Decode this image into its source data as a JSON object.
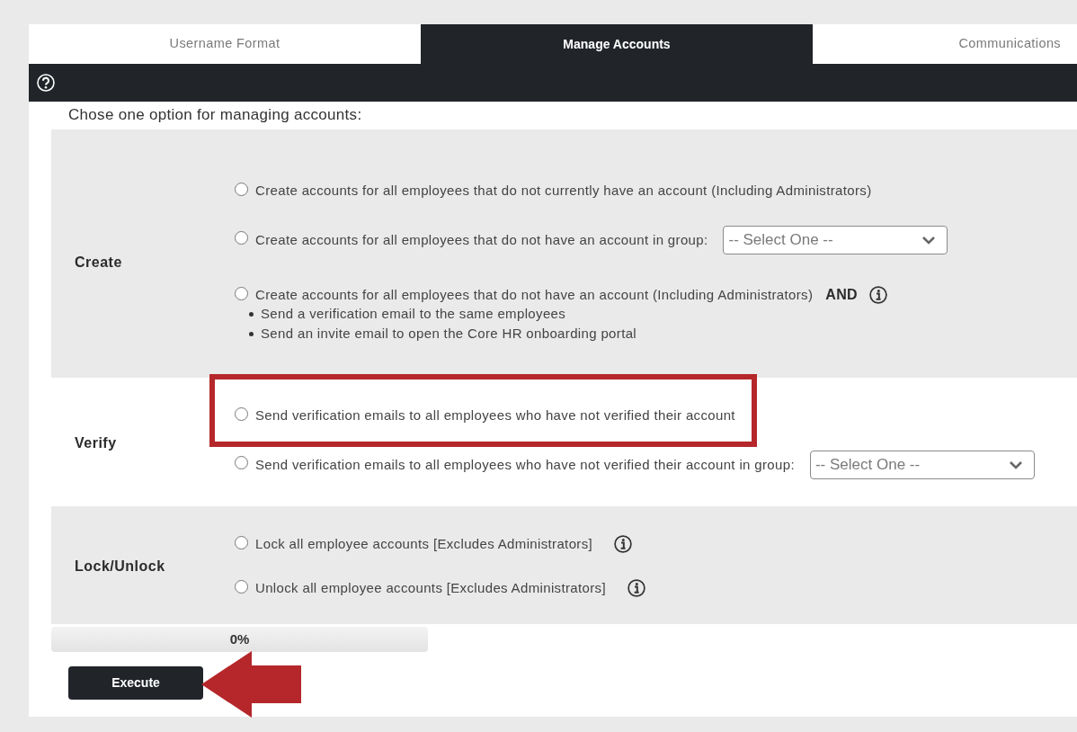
{
  "tabs": [
    {
      "label": "Username Format",
      "selected": false
    },
    {
      "label": "Manage Accounts",
      "selected": true
    },
    {
      "label": "Communications",
      "selected": false
    }
  ],
  "intro": "Chose one option for managing accounts:",
  "sections": [
    {
      "title": "Create",
      "shaded": true,
      "options": [
        {
          "kind": "plain",
          "label": "Create accounts for all employees that do not currently have an account (Including Administrators)",
          "selected": false,
          "highlighted": false,
          "info_icon": false
        },
        {
          "kind": "with-dropdown",
          "label": "Create accounts for all employees that do not have an account in group:",
          "dropdown": {
            "value": "-- Select One --"
          },
          "selected": false,
          "highlighted": false,
          "info_icon": false
        },
        {
          "kind": "with-list",
          "label": "Create accounts for all employees that do not have an account (Including Administrators)",
          "suffix": "AND",
          "bullets": [
            "Send a verification email to the same employees",
            "Send an invite email to open the Core HR onboarding portal"
          ],
          "selected": false,
          "highlighted": false,
          "info_icon": true
        }
      ]
    },
    {
      "title": "Verify",
      "shaded": false,
      "options": [
        {
          "kind": "plain",
          "label": "Send verification emails to all employees who have not verified their account",
          "selected": false,
          "highlighted": true,
          "info_icon": false
        },
        {
          "kind": "with-dropdown",
          "label": "Send verification emails to all employees who have not verified their account in group:",
          "dropdown": {
            "value": "-- Select One --"
          },
          "selected": false,
          "highlighted": false,
          "info_icon": false
        }
      ]
    },
    {
      "title": "Lock/Unlock",
      "shaded": true,
      "options": [
        {
          "kind": "plain",
          "label": "Lock all employee accounts [Excludes Administrators]",
          "selected": false,
          "highlighted": false,
          "info_icon": true
        },
        {
          "kind": "plain",
          "label": "Unlock all employee accounts [Excludes Administrators]",
          "selected": false,
          "highlighted": false,
          "info_icon": true
        }
      ]
    }
  ],
  "progress": {
    "level": 0,
    "reading": "0%"
  },
  "execute": {
    "label": "Execute",
    "callout_arrow": true
  }
}
